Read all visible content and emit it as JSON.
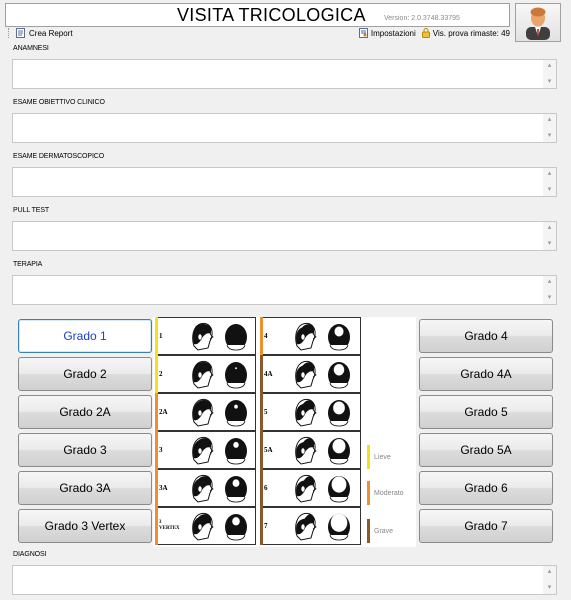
{
  "header": {
    "title": "VISITA TRICOLOGICA",
    "version": "Version: 2.0.3748.33795"
  },
  "toolbar": {
    "create_report": "Crea Report",
    "settings": "Impostazioni",
    "remaining_trials": "Vis. prova rimaste: 49"
  },
  "sections": {
    "anamnesi": "ANAMNESI",
    "esame_obiettivo": "ESAME OBIETTIVO CLINICO",
    "esame_dermatoscopico": "ESAME DERMATOSCOPICO",
    "pull_test": "PULL TEST",
    "terapia": "TERAPIA",
    "diagnosi": "DIAGNOSI"
  },
  "grades_left": [
    "Grado 1",
    "Grado 2",
    "Grado 2A",
    "Grado 3",
    "Grado 3A",
    "Grado 3 Vertex"
  ],
  "grades_right": [
    "Grado 4",
    "Grado 4A",
    "Grado 5",
    "Grado 5A",
    "Grado 6",
    "Grado 7"
  ],
  "selected_grade": "Grado 1",
  "chart": {
    "left_rows": [
      "1",
      "2",
      "2A",
      "3",
      "3A",
      "3 VERTEX"
    ],
    "right_rows": [
      "4",
      "4A",
      "5",
      "5A",
      "6",
      "7"
    ],
    "legend": [
      {
        "label": "Lieve",
        "color": "#f3e21a"
      },
      {
        "label": "Moderato",
        "color": "#f0902a"
      },
      {
        "label": "Grave",
        "color": "#8b5a2b"
      }
    ]
  },
  "colors": {
    "lieve": "#f3e21a",
    "moderato": "#f0902a",
    "grave": "#8b5a2b",
    "selected_text": "#1a3fd0",
    "selected_border": "#3c7fb1"
  }
}
